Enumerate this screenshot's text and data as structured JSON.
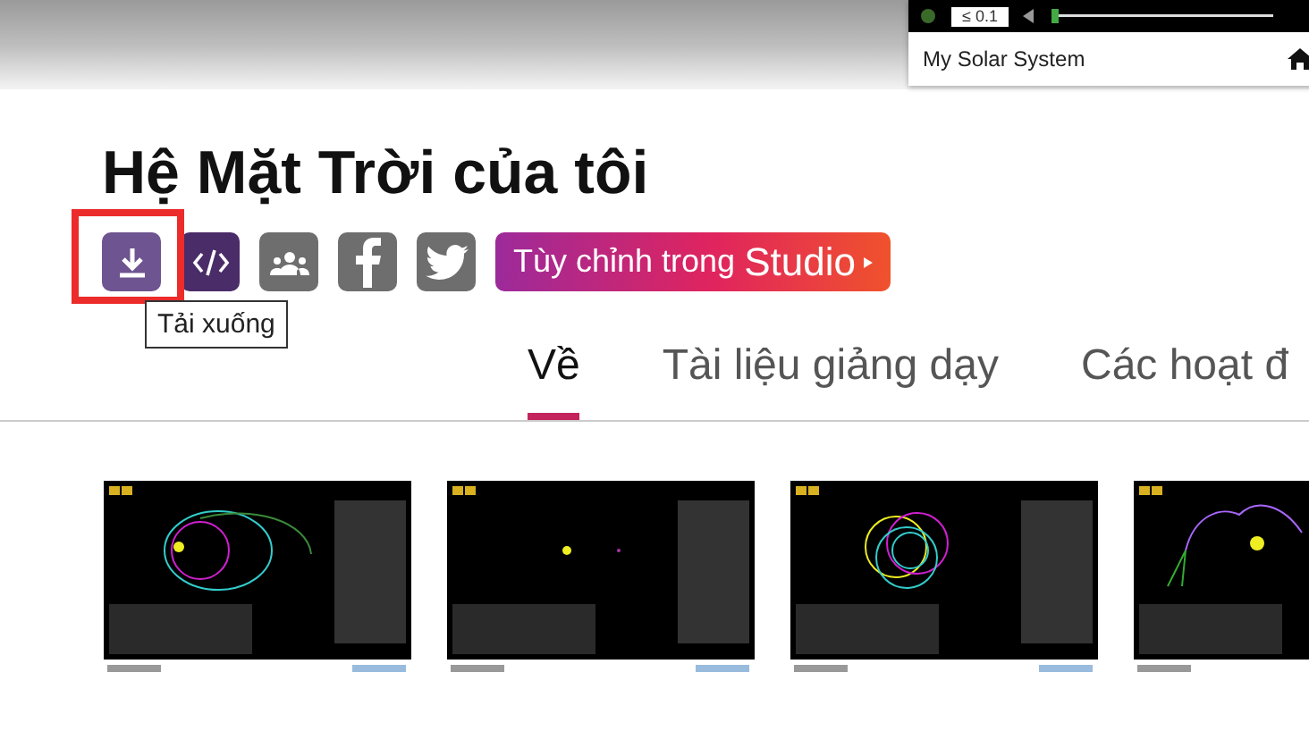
{
  "top_card": {
    "reading": "≤ 0.1",
    "caption": "My Solar System"
  },
  "title": "Hệ Mặt Trời của tôi",
  "share_buttons": [
    {
      "kind": "download"
    },
    {
      "kind": "embed"
    },
    {
      "kind": "classroom"
    },
    {
      "kind": "facebook"
    },
    {
      "kind": "twitter"
    }
  ],
  "studio_button": {
    "label": "Tùy chỉnh trong",
    "brand": "Studio"
  },
  "tooltip": "Tải xuống",
  "tabs": [
    {
      "label": "Về",
      "selected": true
    },
    {
      "label": "Tài liệu giảng dạy",
      "selected": false
    },
    {
      "label": "Các hoạt đ",
      "selected": false
    }
  ]
}
